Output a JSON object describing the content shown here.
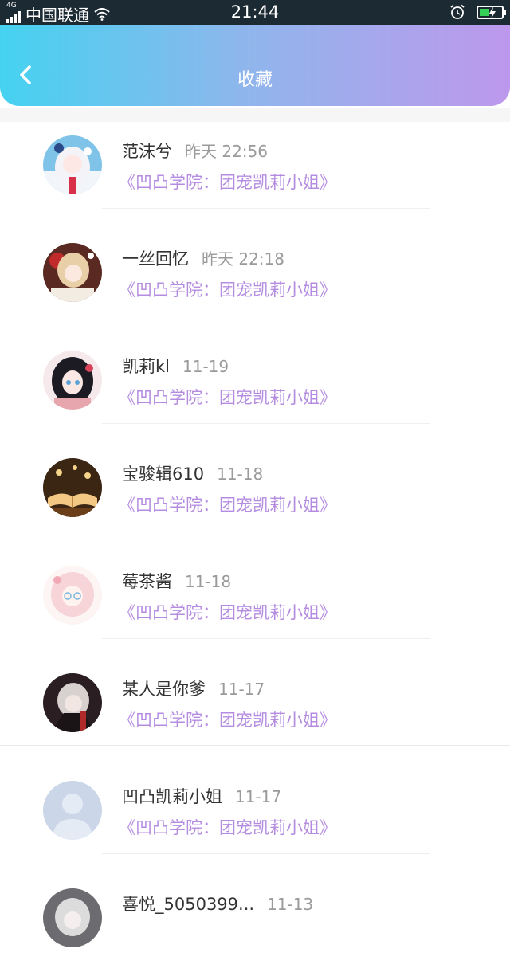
{
  "status_bar": {
    "network_type": "4G",
    "carrier": "中国联通",
    "time": "21:44",
    "icons": [
      "signal-icon",
      "wifi-icon",
      "alarm-icon",
      "battery-charging-icon"
    ]
  },
  "header": {
    "title": "收藏",
    "back_icon": "chevron-left-icon",
    "gradient": [
      "#45d2f0",
      "#bd98ec"
    ]
  },
  "colors": {
    "name_text": "#333333",
    "time_text": "#9a9a9a",
    "link_text": "#b58de0"
  },
  "favorites": [
    {
      "name": "范沫兮",
      "time": "昨天 22:56",
      "target": "《凹凸学院：团宠凯莉小姐》",
      "avatar": "anime-avatar-white-hair"
    },
    {
      "name": "一丝回忆",
      "time": "昨天 22:18",
      "target": "《凹凸学院：团宠凯莉小姐》",
      "avatar": "anime-avatar-blonde-red"
    },
    {
      "name": "凯莉kl",
      "time": "11-19",
      "target": "《凹凸学院：团宠凯莉小姐》",
      "avatar": "anime-avatar-black-hair"
    },
    {
      "name": "宝骏辑610",
      "time": "11-18",
      "target": "《凹凸学院：团宠凯莉小姐》",
      "avatar": "open-book-avatar"
    },
    {
      "name": "莓茶酱",
      "time": "11-18",
      "target": "《凹凸学院：团宠凯莉小姐》",
      "avatar": "anime-avatar-pink-glasses"
    },
    {
      "name": "某人是你爹",
      "time": "11-17",
      "target": "《凹凸学院：团宠凯莉小姐》",
      "avatar": "anime-avatar-dark"
    },
    {
      "name": "凹凸凯莉小姐",
      "time": "11-17",
      "target": "《凹凸学院：团宠凯莉小姐》",
      "avatar": "default-user-avatar"
    },
    {
      "name": "喜悦_5050399...",
      "time": "11-13",
      "target": "",
      "avatar": "anime-avatar-gray"
    }
  ]
}
